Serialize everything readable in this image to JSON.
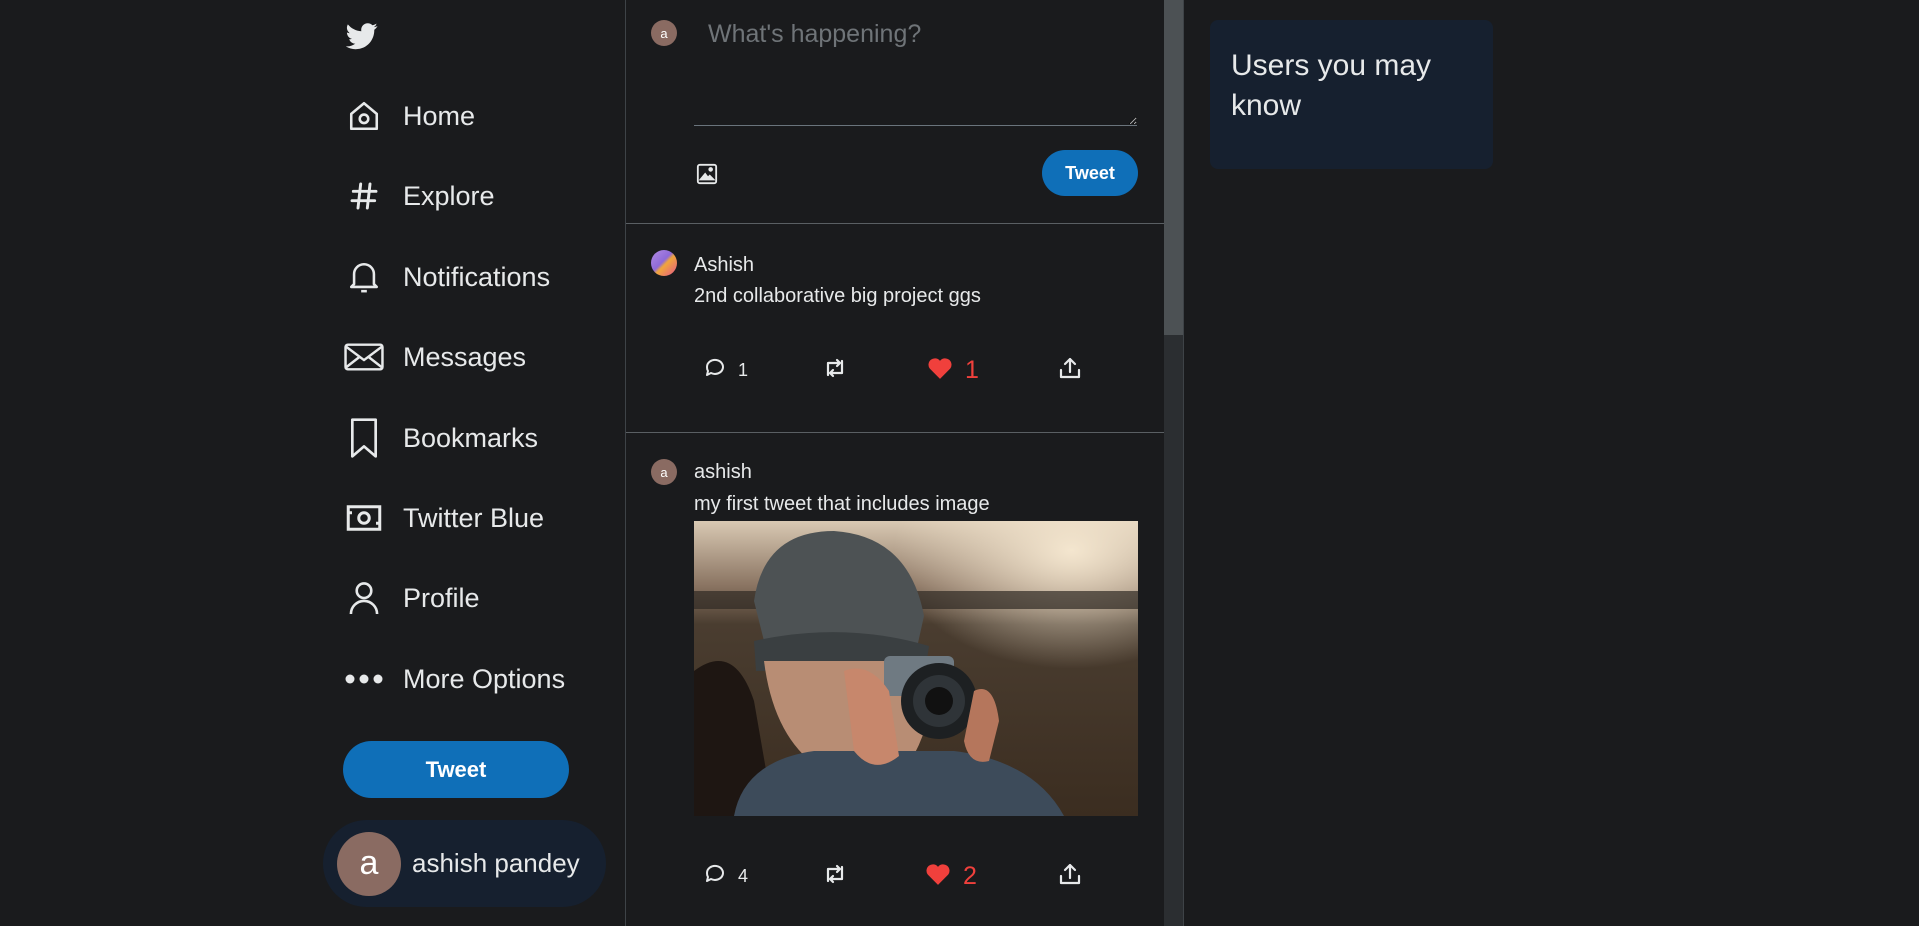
{
  "sidebar": {
    "logo": "twitter-bird-icon",
    "items": [
      {
        "label": "Home",
        "icon": "home-icon"
      },
      {
        "label": "Explore",
        "icon": "hashtag-icon"
      },
      {
        "label": "Notifications",
        "icon": "bell-icon"
      },
      {
        "label": "Messages",
        "icon": "envelope-icon"
      },
      {
        "label": "Bookmarks",
        "icon": "bookmark-icon"
      },
      {
        "label": "Twitter Blue",
        "icon": "money-icon"
      },
      {
        "label": "Profile",
        "icon": "user-icon"
      },
      {
        "label": "More Options",
        "icon": "more-dots-icon"
      }
    ],
    "tweet_button": "Tweet",
    "account": {
      "avatar_letter": "a",
      "name": "ashish pandey"
    }
  },
  "compose": {
    "avatar_letter": "a",
    "placeholder": "What's happening?",
    "tweet_button": "Tweet"
  },
  "tweets": [
    {
      "author": "Ashish",
      "text": "2nd collaborative big project ggs",
      "replies": "1",
      "likes": "1",
      "liked": true
    },
    {
      "author": "ashish",
      "avatar_letter": "a",
      "text": "my first tweet that includes image",
      "replies": "4",
      "likes": "2",
      "liked": true
    }
  ],
  "right_panel": {
    "title": "Users you may know"
  },
  "colors": {
    "background": "#1a1b1d",
    "accent": "#0f6fb8",
    "like": "#f0403c",
    "panel": "#16202f"
  }
}
